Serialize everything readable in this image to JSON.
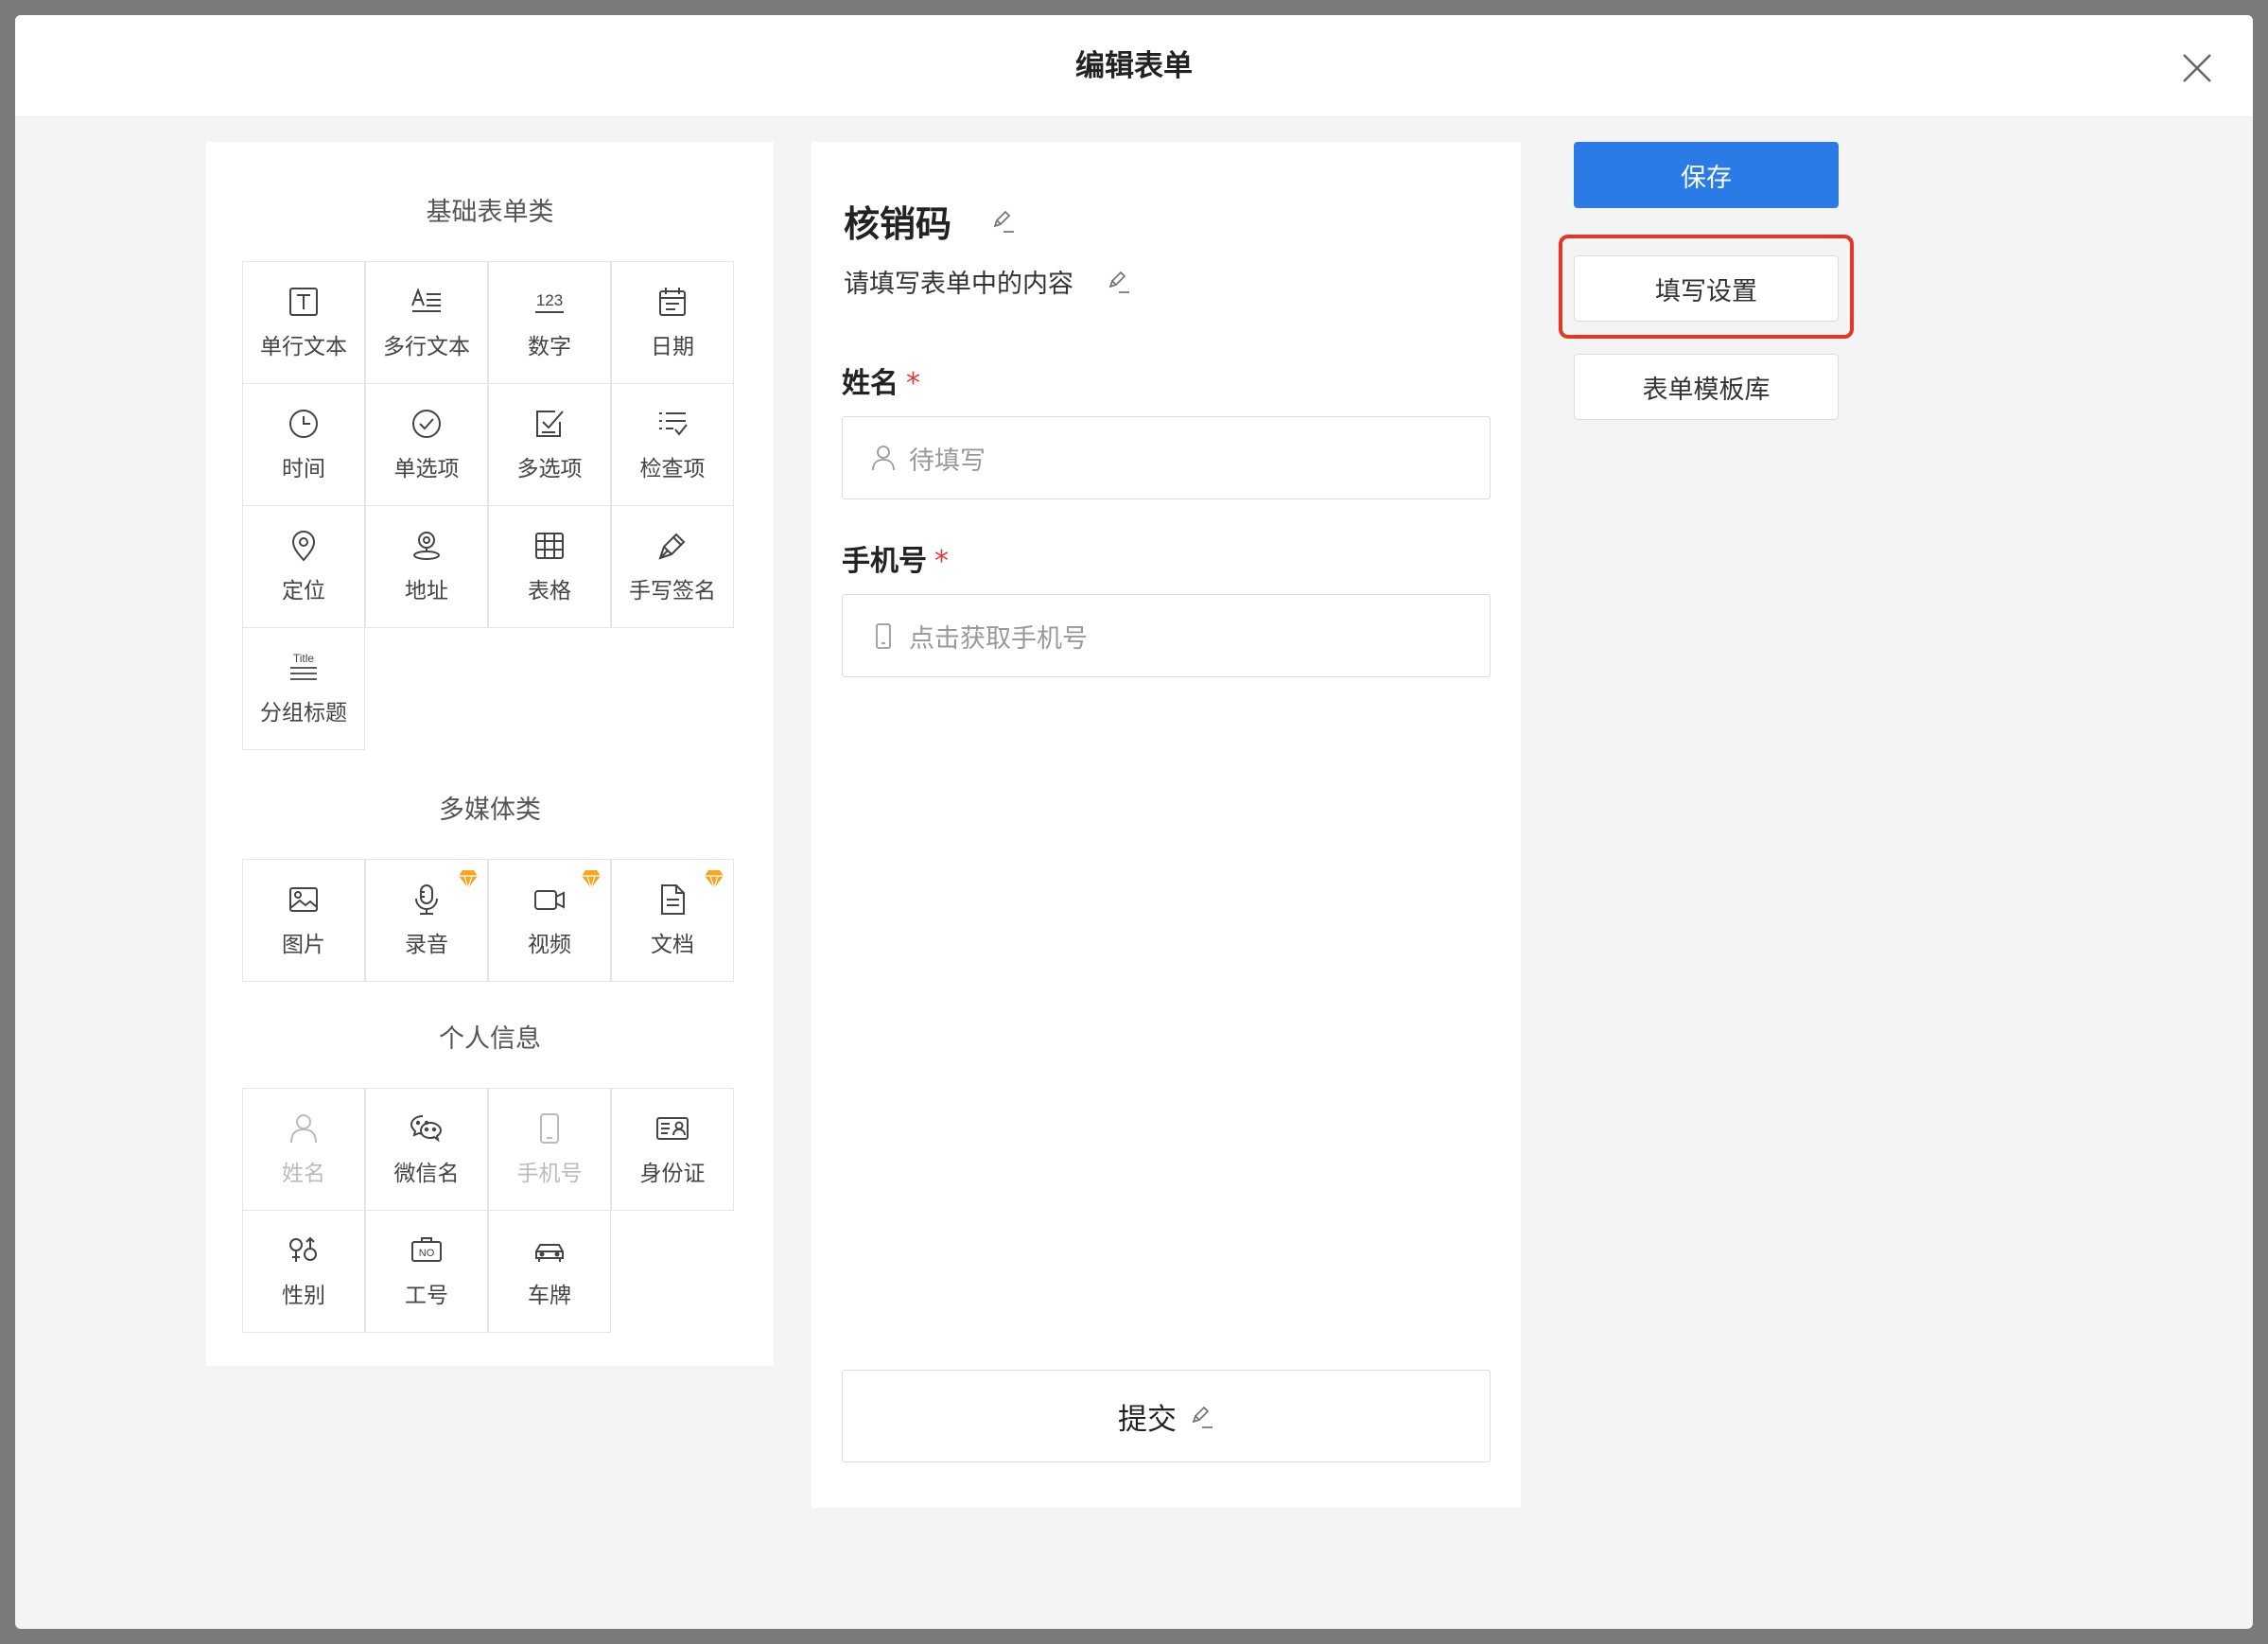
{
  "modal": {
    "title": "编辑表单"
  },
  "palette": {
    "basic": {
      "title": "基础表单类",
      "items": [
        {
          "label": "单行文本",
          "icon": "text-single-icon"
        },
        {
          "label": "多行文本",
          "icon": "text-multi-icon"
        },
        {
          "label": "数字",
          "icon": "number-icon"
        },
        {
          "label": "日期",
          "icon": "calendar-icon"
        },
        {
          "label": "时间",
          "icon": "clock-icon"
        },
        {
          "label": "单选项",
          "icon": "radio-check-icon"
        },
        {
          "label": "多选项",
          "icon": "checkbox-icon"
        },
        {
          "label": "检查项",
          "icon": "checklist-icon"
        },
        {
          "label": "定位",
          "icon": "location-pin-icon"
        },
        {
          "label": "地址",
          "icon": "address-icon"
        },
        {
          "label": "表格",
          "icon": "table-icon"
        },
        {
          "label": "手写签名",
          "icon": "pen-icon"
        },
        {
          "label": "分组标题",
          "icon": "group-title-icon",
          "icon_text": "Title"
        }
      ]
    },
    "media": {
      "title": "多媒体类",
      "items": [
        {
          "label": "图片",
          "icon": "image-icon",
          "vip": false
        },
        {
          "label": "录音",
          "icon": "microphone-icon",
          "vip": true
        },
        {
          "label": "视频",
          "icon": "video-icon",
          "vip": true
        },
        {
          "label": "文档",
          "icon": "document-icon",
          "vip": true
        }
      ]
    },
    "personal": {
      "title": "个人信息",
      "items": [
        {
          "label": "姓名",
          "icon": "user-icon",
          "disabled": true
        },
        {
          "label": "微信名",
          "icon": "wechat-icon",
          "disabled": false
        },
        {
          "label": "手机号",
          "icon": "phone-icon",
          "disabled": true
        },
        {
          "label": "身份证",
          "icon": "id-card-icon",
          "disabled": false
        },
        {
          "label": "性别",
          "icon": "gender-icon",
          "disabled": false
        },
        {
          "label": "工号",
          "icon": "employee-no-icon",
          "disabled": false,
          "icon_text": "NO"
        },
        {
          "label": "车牌",
          "icon": "car-icon",
          "disabled": false
        }
      ]
    }
  },
  "preview": {
    "title": "核销码",
    "description": "请填写表单中的内容",
    "fields": [
      {
        "label": "姓名",
        "required_mark": "*",
        "placeholder": "待填写",
        "icon": "user-icon"
      },
      {
        "label": "手机号",
        "required_mark": "*",
        "placeholder": "点击获取手机号",
        "icon": "phone-icon"
      }
    ],
    "submit_label": "提交"
  },
  "actions": {
    "save": "保存",
    "fill_settings": "填写设置",
    "template_library": "表单模板库"
  },
  "colors": {
    "primary": "#2a7be6",
    "highlight": "#e53523",
    "required": "#e53935",
    "vip": "#f5a623"
  }
}
